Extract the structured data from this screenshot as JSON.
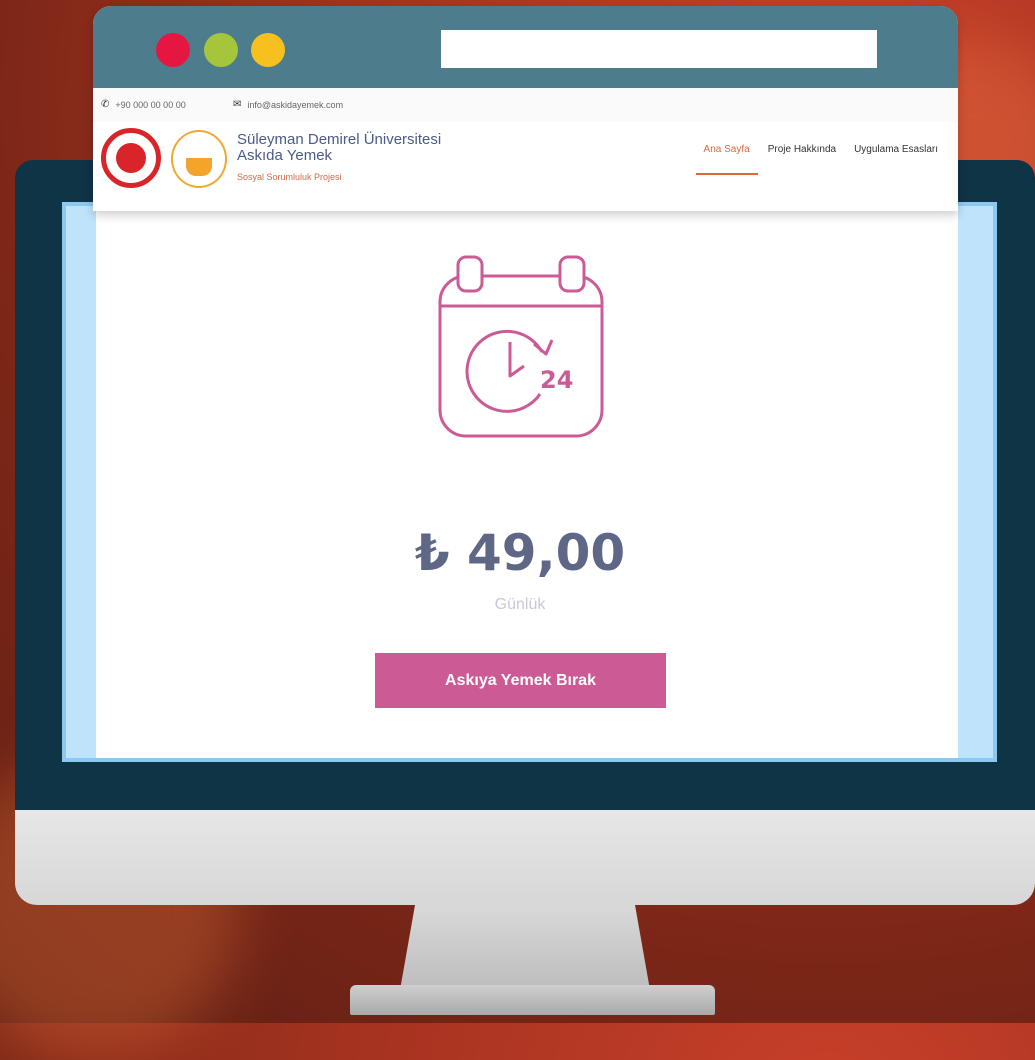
{
  "browser": {
    "address_bar_value": ""
  },
  "topbar": {
    "phone": "+90 000 00 00 00",
    "email": "info@askidayemek.com"
  },
  "site": {
    "title": "Süleyman Demirel Üniversitesi Askıda Yemek",
    "subtitle": "Sosyal Sorumluluk Projesi"
  },
  "nav": {
    "items": [
      {
        "label": "Ana Sayfa",
        "active": true
      },
      {
        "label": "Proje Hakkında",
        "active": false
      },
      {
        "label": "Uygulama Esasları",
        "active": false
      }
    ]
  },
  "main": {
    "icon_badge": "24",
    "price": "₺ 49,00",
    "period": "Günlük",
    "cta_label": "Askıya Yemek Bırak"
  },
  "colors": {
    "accent": "#cc5a95",
    "price_text": "#5f6787",
    "nav_active": "#e0663e",
    "browser_bar": "#4d7d8c"
  }
}
